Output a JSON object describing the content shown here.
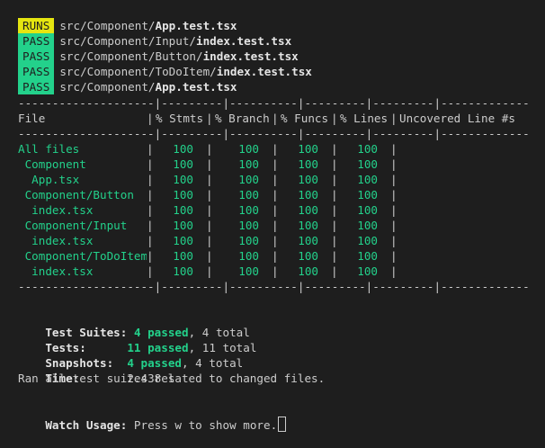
{
  "run_lines": [
    {
      "badge": "RUNS",
      "dir": "src/Component/",
      "file": "App.test.tsx"
    },
    {
      "badge": "PASS",
      "dir": "src/Component/Input/",
      "file": "index.test.tsx"
    },
    {
      "badge": "PASS",
      "dir": "src/Component/Button/",
      "file": "index.test.tsx"
    },
    {
      "badge": "PASS",
      "dir": "src/Component/ToDoItem/",
      "file": "index.test.tsx"
    },
    {
      "badge": "PASS",
      "dir": "src/Component/",
      "file": "App.test.tsx"
    }
  ],
  "separator": "--------------------|---------|----------|---------|---------|-------------------",
  "coverage_headers": [
    "File",
    "% Stmts",
    "% Branch",
    "% Funcs",
    "% Lines",
    "Uncovered Line #s"
  ],
  "coverage_rows": [
    {
      "name": "All files",
      "values": [
        "100",
        "100",
        "100",
        "100"
      ],
      "uncovered": ""
    },
    {
      "name": " Component",
      "values": [
        "100",
        "100",
        "100",
        "100"
      ],
      "uncovered": ""
    },
    {
      "name": "  App.tsx",
      "values": [
        "100",
        "100",
        "100",
        "100"
      ],
      "uncovered": ""
    },
    {
      "name": " Component/Button",
      "values": [
        "100",
        "100",
        "100",
        "100"
      ],
      "uncovered": ""
    },
    {
      "name": "  index.tsx",
      "values": [
        "100",
        "100",
        "100",
        "100"
      ],
      "uncovered": ""
    },
    {
      "name": " Component/Input",
      "values": [
        "100",
        "100",
        "100",
        "100"
      ],
      "uncovered": ""
    },
    {
      "name": "  index.tsx",
      "values": [
        "100",
        "100",
        "100",
        "100"
      ],
      "uncovered": ""
    },
    {
      "name": " Component/ToDoItem",
      "values": [
        "100",
        "100",
        "100",
        "100"
      ],
      "uncovered": ""
    },
    {
      "name": "  index.tsx",
      "values": [
        "100",
        "100",
        "100",
        "100"
      ],
      "uncovered": ""
    }
  ],
  "summary": {
    "suites_label": "Test Suites:",
    "suites_passed": "4 passed",
    "suites_total": ", 4 total",
    "tests_label": "Tests:",
    "tests_passed": "11 passed",
    "tests_total": ", 11 total",
    "snapshots_label": "Snapshots:",
    "snapshots_passed": "4 passed",
    "snapshots_total": ", 4 total",
    "time_label": "Time:",
    "time_value": "2.438 s",
    "ran_all": "Ran all test suites related to changed files."
  },
  "watch": {
    "label": "Watch Usage:",
    "text": " Press w to show more."
  },
  "colors": {
    "background": "#1e1e1e",
    "text": "#cccccc",
    "green": "#23d18b",
    "yellow": "#e5e510"
  }
}
